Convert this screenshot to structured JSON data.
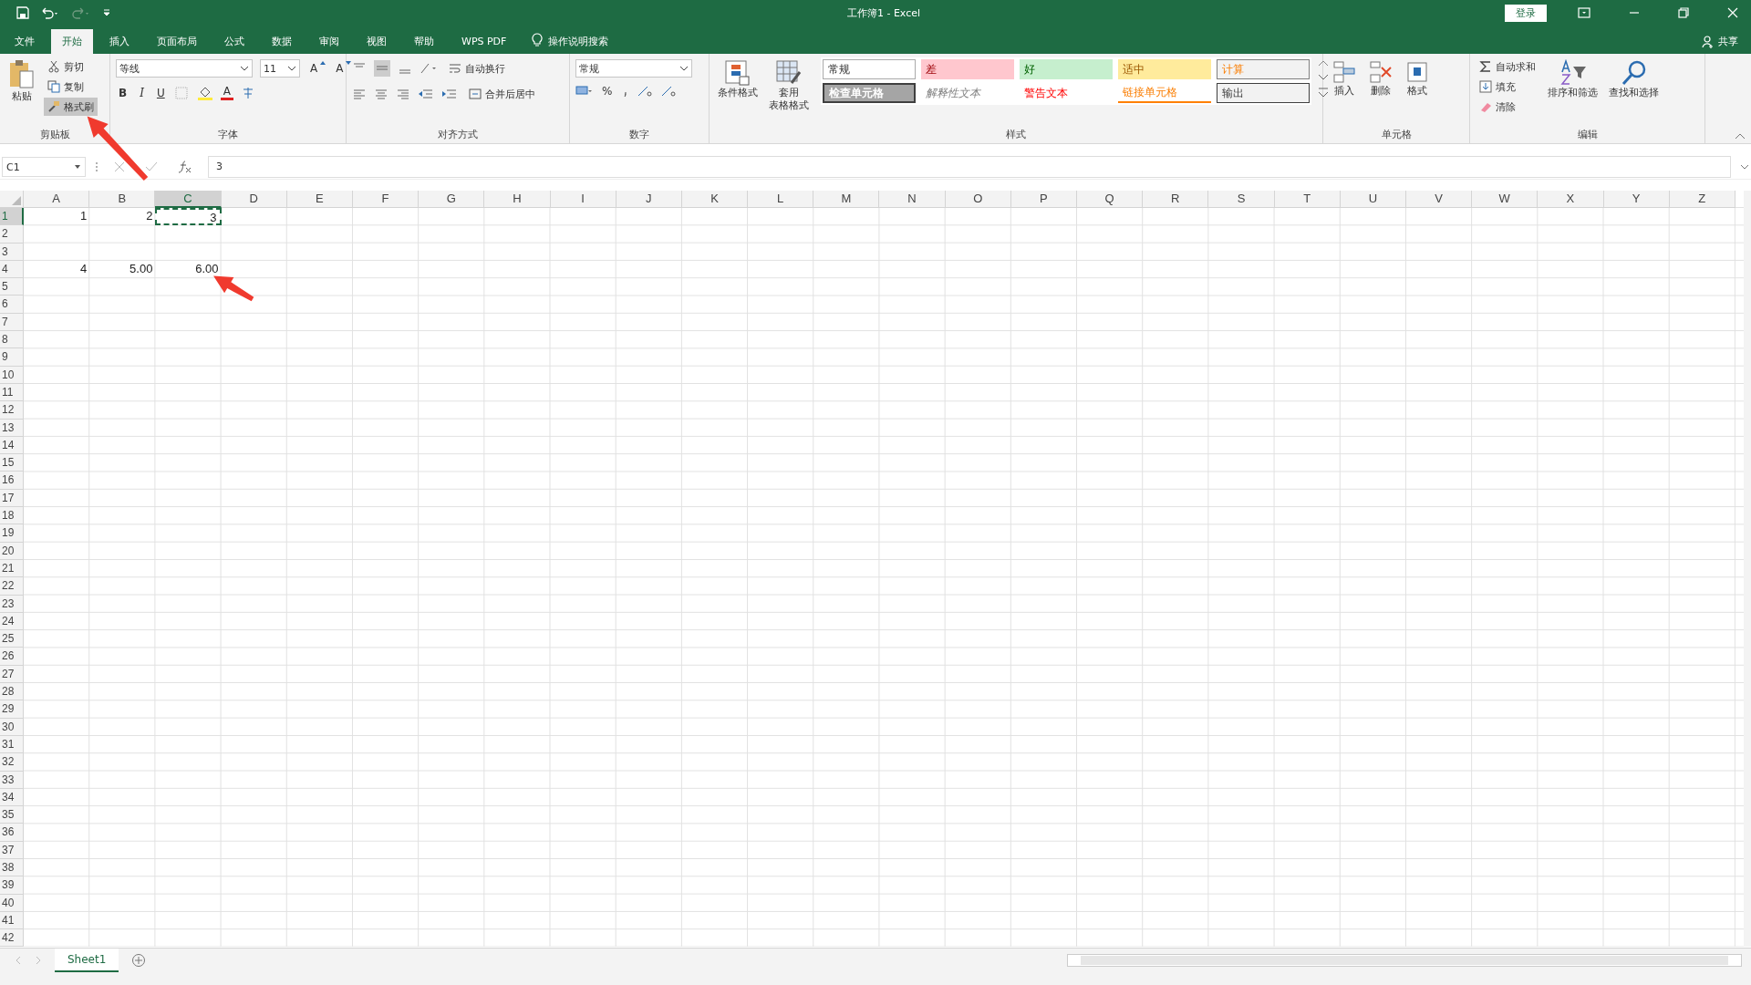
{
  "window": {
    "title": "工作簿1 - Excel",
    "login": "登录"
  },
  "tabs": [
    {
      "label": "文件",
      "selected": false
    },
    {
      "label": "开始",
      "selected": true
    },
    {
      "label": "插入",
      "selected": false
    },
    {
      "label": "页面布局",
      "selected": false
    },
    {
      "label": "公式",
      "selected": false
    },
    {
      "label": "数据",
      "selected": false
    },
    {
      "label": "审阅",
      "selected": false
    },
    {
      "label": "视图",
      "selected": false
    },
    {
      "label": "帮助",
      "selected": false
    },
    {
      "label": "WPS PDF",
      "selected": false
    }
  ],
  "tell_me": "操作说明搜索",
  "share": "共享",
  "ribbon": {
    "clipboard": {
      "label": "剪贴板",
      "paste": "粘贴",
      "items": [
        {
          "label": "剪切",
          "selected": false
        },
        {
          "label": "复制",
          "selected": false
        },
        {
          "label": "格式刷",
          "selected": true
        }
      ]
    },
    "font": {
      "label": "字体",
      "name": "等线",
      "size": "11",
      "grow": "A",
      "shrink": "A",
      "bold": "B",
      "italic": "I",
      "underline": "U",
      "color_letter": "A"
    },
    "alignment": {
      "label": "对齐方式",
      "wrap": "自动换行",
      "merge": "合并后居中"
    },
    "number": {
      "label": "数字",
      "format": "常规",
      "percent": "%"
    },
    "styles": {
      "label": "样式",
      "conditional": "条件格式",
      "table": [
        "套用",
        "表格格式"
      ],
      "gallery": [
        {
          "kind": "normal",
          "text": "常规"
        },
        {
          "kind": "bad",
          "text": "差"
        },
        {
          "kind": "good",
          "text": "好"
        },
        {
          "kind": "neutral",
          "text": "适中"
        },
        {
          "kind": "calculation",
          "text": "计算"
        },
        {
          "kind": "check",
          "text": "检查单元格"
        },
        {
          "kind": "explanatory",
          "text": "解释性文本"
        },
        {
          "kind": "warning",
          "text": "警告文本"
        },
        {
          "kind": "linked",
          "text": "链接单元格"
        },
        {
          "kind": "output",
          "text": "输出"
        }
      ]
    },
    "cells": {
      "label": "单元格",
      "items": [
        "插入",
        "删除",
        "格式"
      ]
    },
    "editing": {
      "label": "编辑",
      "autosum": "自动求和",
      "fill": "填充",
      "clear": "清除",
      "sort": "排序和筛选",
      "find": "查找和选择"
    }
  },
  "formula_bar": {
    "name_box": "C1",
    "formula": "3"
  },
  "columns": [
    {
      "label": "A",
      "selected": false
    },
    {
      "label": "B",
      "selected": false
    },
    {
      "label": "C",
      "selected": true
    },
    {
      "label": "D",
      "selected": false
    },
    {
      "label": "E",
      "selected": false
    },
    {
      "label": "F",
      "selected": false
    },
    {
      "label": "G",
      "selected": false
    },
    {
      "label": "H",
      "selected": false
    },
    {
      "label": "I",
      "selected": false
    },
    {
      "label": "J",
      "selected": false
    },
    {
      "label": "K",
      "selected": false
    },
    {
      "label": "L",
      "selected": false
    },
    {
      "label": "M",
      "selected": false
    },
    {
      "label": "N",
      "selected": false
    },
    {
      "label": "O",
      "selected": false
    },
    {
      "label": "P",
      "selected": false
    },
    {
      "label": "Q",
      "selected": false
    },
    {
      "label": "R",
      "selected": false
    },
    {
      "label": "S",
      "selected": false
    },
    {
      "label": "T",
      "selected": false
    },
    {
      "label": "U",
      "selected": false
    },
    {
      "label": "V",
      "selected": false
    },
    {
      "label": "W",
      "selected": false
    },
    {
      "label": "X",
      "selected": false
    },
    {
      "label": "Y",
      "selected": false
    },
    {
      "label": "Z",
      "selected": false
    }
  ],
  "rows": [
    {
      "number": "1",
      "selected": true,
      "cells": [
        {
          "value": "1",
          "selected": false
        },
        {
          "value": "2",
          "selected": false
        },
        {
          "value": "3",
          "selected": true
        }
      ]
    },
    {
      "number": "2",
      "selected": false
    },
    {
      "number": "3",
      "selected": false
    },
    {
      "number": "4",
      "selected": false,
      "cells": [
        {
          "value": "4",
          "selected": false
        },
        {
          "value": "5.00",
          "selected": false
        },
        {
          "value": "6.00",
          "selected": false
        }
      ]
    },
    {
      "number": "5",
      "selected": false
    },
    {
      "number": "6",
      "selected": false
    },
    {
      "number": "7",
      "selected": false
    },
    {
      "number": "8",
      "selected": false
    },
    {
      "number": "9",
      "selected": false
    },
    {
      "number": "10",
      "selected": false
    },
    {
      "number": "11",
      "selected": false
    },
    {
      "number": "12",
      "selected": false
    },
    {
      "number": "13",
      "selected": false
    },
    {
      "number": "14",
      "selected": false
    },
    {
      "number": "15",
      "selected": false
    },
    {
      "number": "16",
      "selected": false
    },
    {
      "number": "17",
      "selected": false
    },
    {
      "number": "18",
      "selected": false
    },
    {
      "number": "19",
      "selected": false
    },
    {
      "number": "20",
      "selected": false
    },
    {
      "number": "21",
      "selected": false
    },
    {
      "number": "22",
      "selected": false
    },
    {
      "number": "23",
      "selected": false
    },
    {
      "number": "24",
      "selected": false
    },
    {
      "number": "25",
      "selected": false
    },
    {
      "number": "26",
      "selected": false
    },
    {
      "number": "27",
      "selected": false
    },
    {
      "number": "28",
      "selected": false
    },
    {
      "number": "29",
      "selected": false
    },
    {
      "number": "30",
      "selected": false
    },
    {
      "number": "31",
      "selected": false
    },
    {
      "number": "32",
      "selected": false
    },
    {
      "number": "33",
      "selected": false
    },
    {
      "number": "34",
      "selected": false
    },
    {
      "number": "35",
      "selected": false
    },
    {
      "number": "36",
      "selected": false
    },
    {
      "number": "37",
      "selected": false
    },
    {
      "number": "38",
      "selected": false
    },
    {
      "number": "39",
      "selected": false
    },
    {
      "number": "40",
      "selected": false
    },
    {
      "number": "41",
      "selected": false
    },
    {
      "number": "42",
      "selected": false
    }
  ],
  "sheets": [
    {
      "label": "Sheet1",
      "selected": true
    }
  ]
}
